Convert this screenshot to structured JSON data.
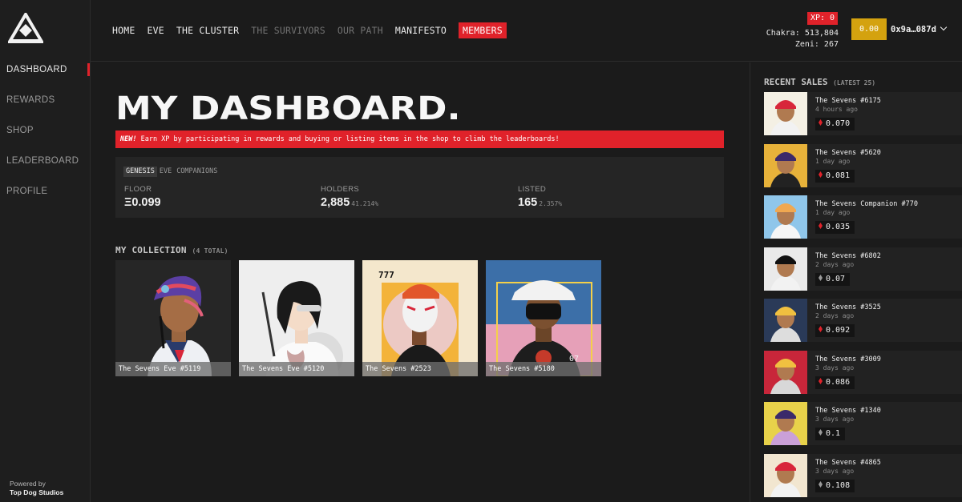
{
  "sidebar": {
    "items": [
      {
        "label": "DASHBOARD",
        "active": true
      },
      {
        "label": "REWARDS",
        "active": false
      },
      {
        "label": "SHOP",
        "active": false
      },
      {
        "label": "LEADERBOARD",
        "active": false
      },
      {
        "label": "PROFILE",
        "active": false
      }
    ],
    "powered_by": "Powered by",
    "powered_company": "Top Dog Studios"
  },
  "topnav": {
    "items": [
      {
        "label": "HOME"
      },
      {
        "label": "EVE"
      },
      {
        "label": "THE CLUSTER"
      },
      {
        "label": "THE SURVIVORS"
      },
      {
        "label": "OUR PATH"
      },
      {
        "label": "MANIFESTO"
      },
      {
        "label": "MEMBERS"
      }
    ]
  },
  "account": {
    "xp": "XP: 0",
    "chakra": "Chakra: 513,804",
    "zeni": "Zeni: 267",
    "wallet_balance": "0.00",
    "wallet_address": "0x9a…087d"
  },
  "main": {
    "title": "MY DASHBOARD.",
    "banner_new": "NEW!",
    "banner_text": " Earn XP by participating in rewards and buying or listing items in the shop to climb the leaderboards!",
    "stats_tabs": [
      "GENESIS",
      "EVE",
      "COMPANIONS"
    ],
    "stats": [
      {
        "label": "FLOOR",
        "value": "Ξ0.099",
        "sub": ""
      },
      {
        "label": "HOLDERS",
        "value": "2,885",
        "sub": "41.214%"
      },
      {
        "label": "LISTED",
        "value": "165",
        "sub": "2.357%"
      }
    ],
    "collection_title": "MY COLLECTION",
    "collection_count": "(4 TOTAL)",
    "collection": [
      {
        "name": "The Sevens Eve #5119"
      },
      {
        "name": "The Sevens Eve #5120"
      },
      {
        "name": "The Sevens #2523"
      },
      {
        "name": "The Sevens #5180"
      }
    ]
  },
  "recent_sales": {
    "title": "RECENT SALES",
    "subtitle": "(LATEST 25)",
    "items": [
      {
        "name": "The Sevens #6175",
        "time": "4 hours ago",
        "price": "0.070",
        "eth_color": "#e0222a"
      },
      {
        "name": "The Sevens #5620",
        "time": "1 day ago",
        "price": "0.081",
        "eth_color": "#e0222a"
      },
      {
        "name": "The Sevens Companion #770",
        "time": "1 day ago",
        "price": "0.035",
        "eth_color": "#e0222a"
      },
      {
        "name": "The Sevens #6802",
        "time": "2 days ago",
        "price": "0.07",
        "eth_color": "#9a9a9a"
      },
      {
        "name": "The Sevens #3525",
        "time": "2 days ago",
        "price": "0.092",
        "eth_color": "#e0222a"
      },
      {
        "name": "The Sevens #3009",
        "time": "3 days ago",
        "price": "0.086",
        "eth_color": "#e0222a"
      },
      {
        "name": "The Sevens #1340",
        "time": "3 days ago",
        "price": "0.1",
        "eth_color": "#9a9a9a"
      },
      {
        "name": "The Sevens #4865",
        "time": "3 days ago",
        "price": "0.108",
        "eth_color": "#9a9a9a"
      }
    ]
  }
}
